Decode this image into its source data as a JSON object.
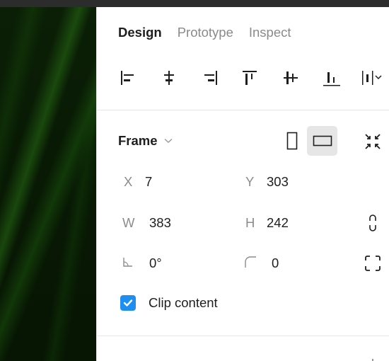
{
  "tabs": [
    {
      "label": "Design",
      "active": true
    },
    {
      "label": "Prototype",
      "active": false
    },
    {
      "label": "Inspect",
      "active": false
    }
  ],
  "alignment": {
    "icons": [
      "align-left-icon",
      "align-horizontal-center-icon",
      "align-right-icon",
      "align-top-icon",
      "align-vertical-center-icon",
      "align-bottom-icon",
      "distribute-icon"
    ]
  },
  "frame": {
    "title": "Frame",
    "orientation": {
      "portrait": false,
      "landscape": true
    },
    "fields": {
      "x": {
        "label": "X",
        "value": "7"
      },
      "y": {
        "label": "Y",
        "value": "303"
      },
      "w": {
        "label": "W",
        "value": "383"
      },
      "h": {
        "label": "H",
        "value": "242"
      },
      "rotation": {
        "value": "0°"
      },
      "radius": {
        "value": "0"
      }
    },
    "clip_content": {
      "label": "Clip content",
      "checked": true
    }
  },
  "colors": {
    "accent": "#1e8ff0",
    "selected_bg": "#e6e6e6",
    "text_primary": "#1e1e1e",
    "text_secondary": "#8c8c8c"
  }
}
